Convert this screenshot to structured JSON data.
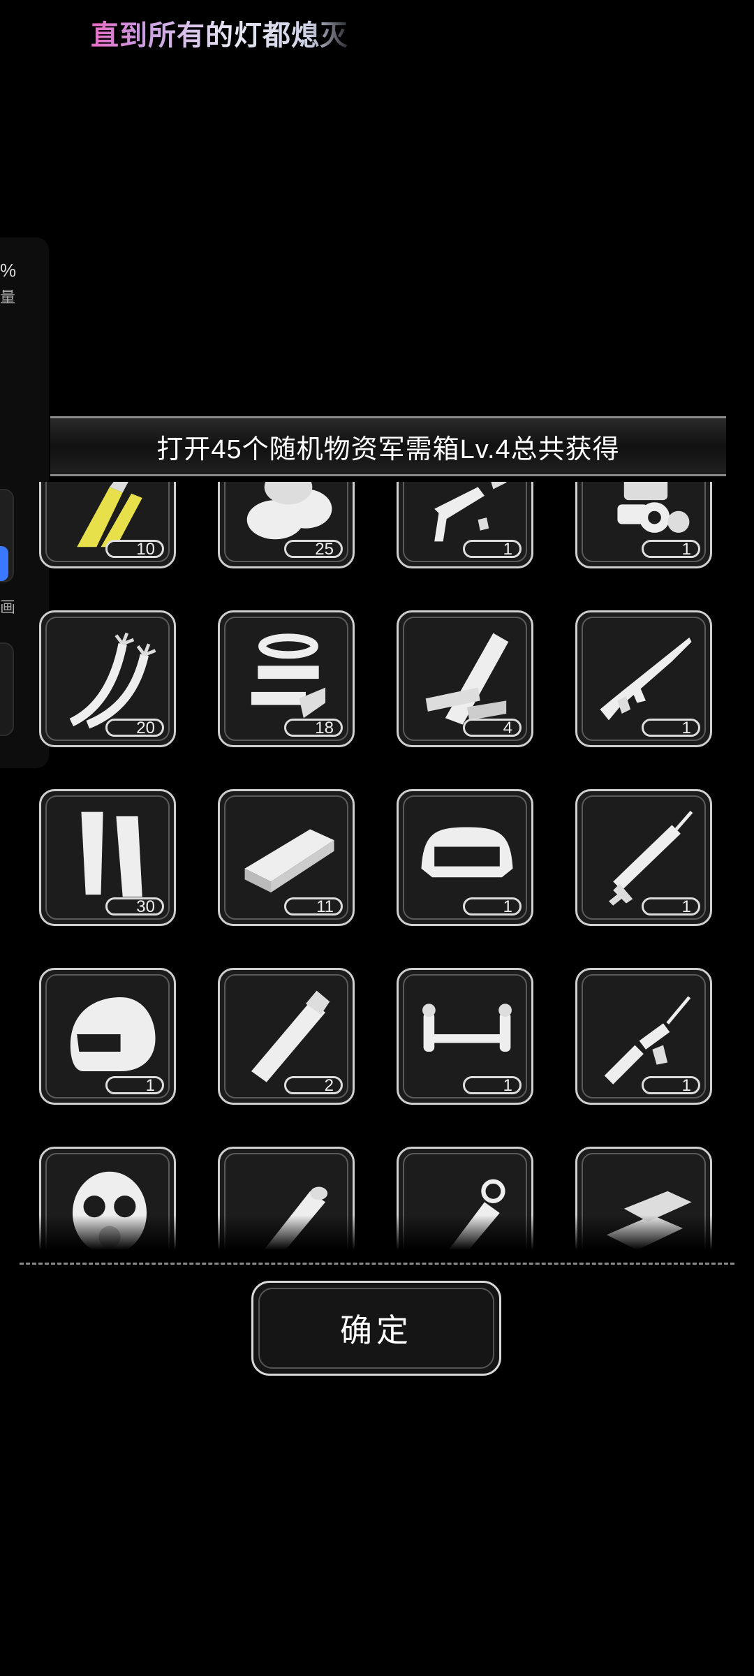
{
  "lyric": "直到所有的灯都熄灭",
  "edge": {
    "percent": "%",
    "volume": "量",
    "picture": "画"
  },
  "banner": {
    "title": "打开45个随机物资军需箱Lv.4总共获得"
  },
  "items": [
    {
      "icon": "knife-blades-icon",
      "count": "10"
    },
    {
      "icon": "cloth-icon",
      "count": "25"
    },
    {
      "icon": "broken-gun-parts-icon",
      "count": "1"
    },
    {
      "icon": "engine-part-icon",
      "count": "1"
    },
    {
      "icon": "wires-icon",
      "count": "20"
    },
    {
      "icon": "tape-rolls-icon",
      "count": "18"
    },
    {
      "icon": "wood-planks-icon",
      "count": "4"
    },
    {
      "icon": "assault-rifle-icon",
      "count": "1"
    },
    {
      "icon": "ammo-magazines-icon",
      "count": "30"
    },
    {
      "icon": "metal-plate-icon",
      "count": "11"
    },
    {
      "icon": "bumper-icon",
      "count": "1"
    },
    {
      "icon": "caulk-gun-icon",
      "count": "1"
    },
    {
      "icon": "helmet-icon",
      "count": "1"
    },
    {
      "icon": "pipe-icon",
      "count": "2"
    },
    {
      "icon": "car-axle-icon",
      "count": "1"
    },
    {
      "icon": "rifle-parts-icon",
      "count": "1"
    },
    {
      "icon": "gas-mask-icon",
      "count": ""
    },
    {
      "icon": "bat-icon",
      "count": ""
    },
    {
      "icon": "tag-icon",
      "count": ""
    },
    {
      "icon": "gold-bars-icon",
      "count": ""
    }
  ],
  "confirm_label": "确定"
}
